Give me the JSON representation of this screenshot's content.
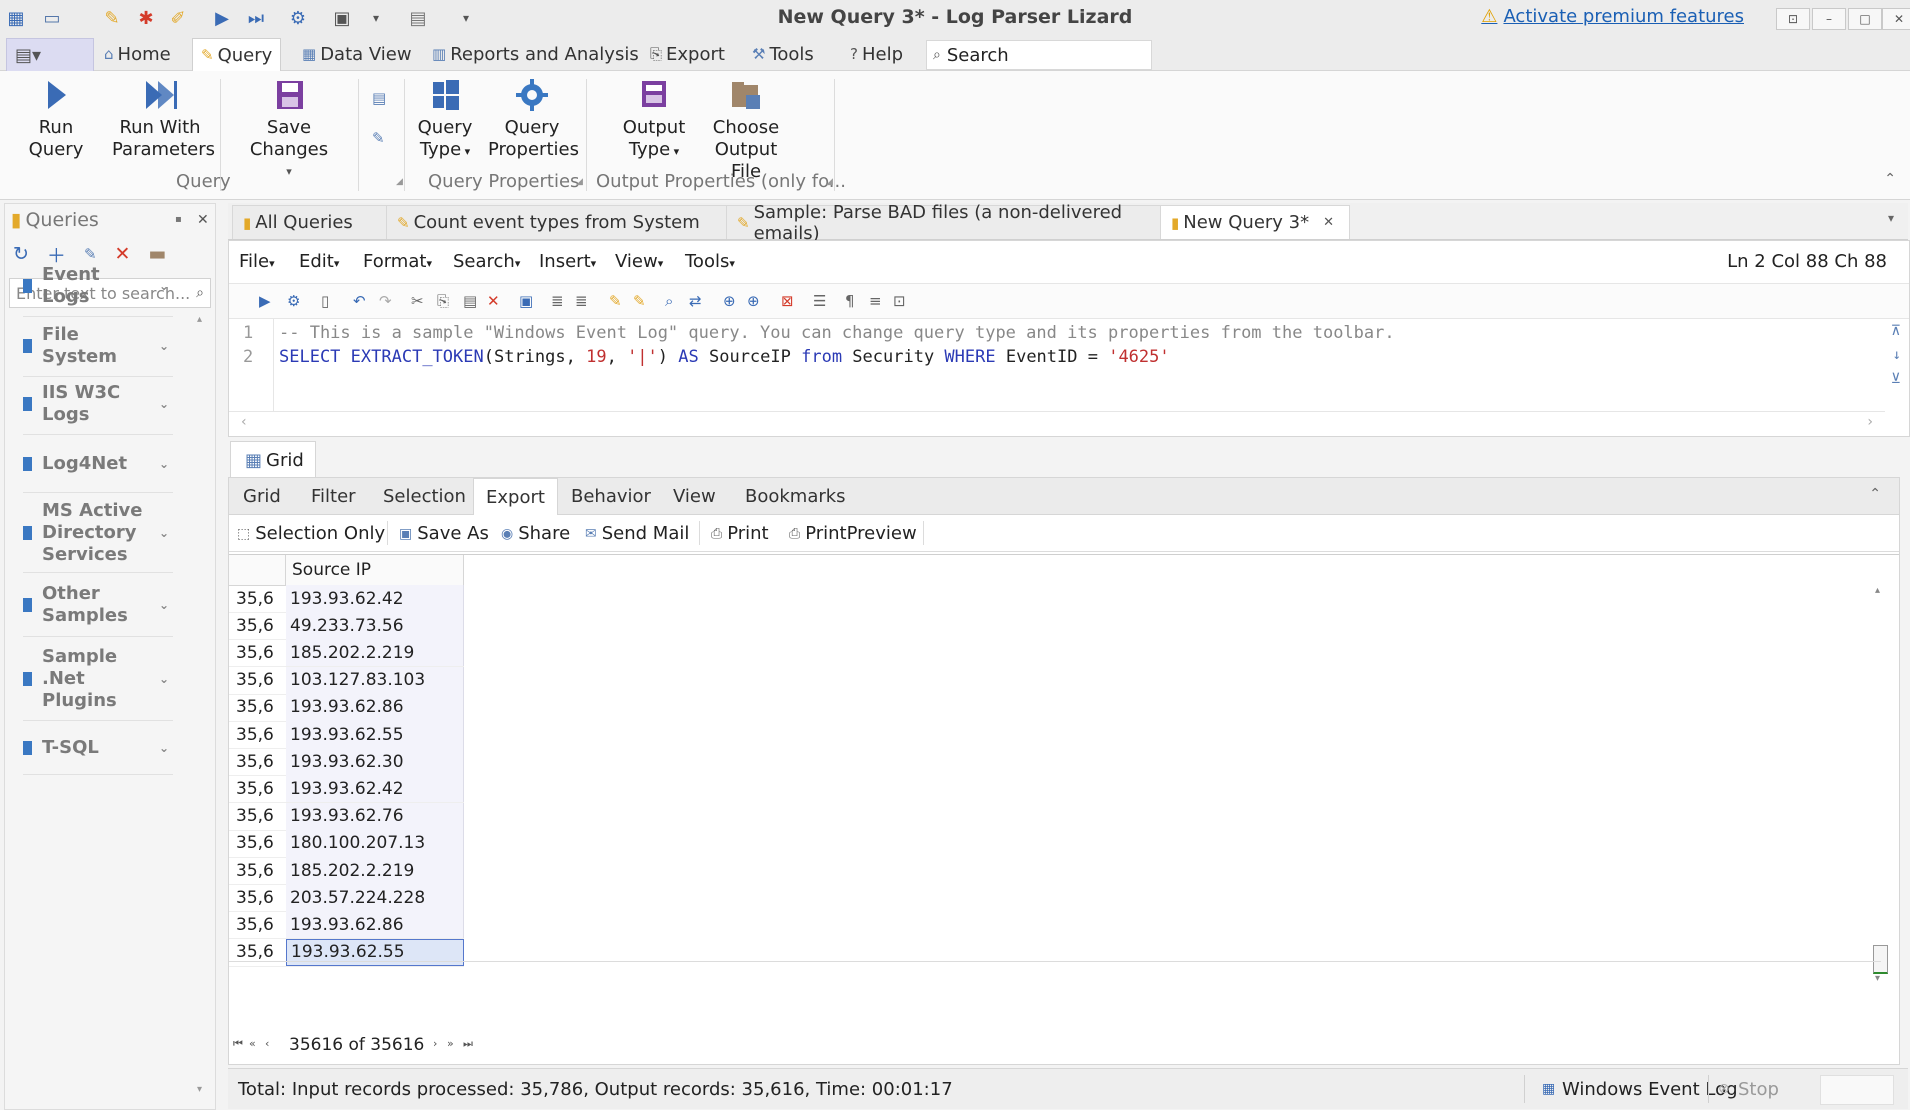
{
  "window": {
    "title": "New Query 3* - Log Parser Lizard",
    "premium_link": "Activate premium features"
  },
  "ribbon_tabs": [
    {
      "label": "Home",
      "icon": "home-icon"
    },
    {
      "label": "Query",
      "icon": "query-icon",
      "active": true
    },
    {
      "label": "Data View",
      "icon": "dataview-icon"
    },
    {
      "label": "Reports and Analysis",
      "icon": "reports-icon"
    },
    {
      "label": "Export",
      "icon": "export-icon"
    },
    {
      "label": "Tools",
      "icon": "tools-icon"
    },
    {
      "label": "Help",
      "icon": "help-icon"
    }
  ],
  "search": {
    "label": "Search"
  },
  "ribbon": {
    "run_query": "Run Query",
    "run_with_params_1": "Run With",
    "run_with_params_2": "Parameters",
    "save_changes": "Save Changes",
    "query_type_1": "Query",
    "query_type_2": "Type",
    "query_props_1": "Query",
    "query_props_2": "Properties",
    "output_type_1": "Output",
    "output_type_2": "Type",
    "choose_output_1": "Choose",
    "choose_output_2": "Output File",
    "group_query": "Query",
    "group_query_props": "Query Properties",
    "group_output_props": "Output Properties (only fo..."
  },
  "left_panel": {
    "title": "Queries",
    "search_placeholder": "Enter text to search...",
    "items": [
      {
        "line1": "Event",
        "line2": "Logs"
      },
      {
        "line1": "File",
        "line2": "System"
      },
      {
        "line1": "IIS W3C",
        "line2": "Logs"
      },
      {
        "line1": "Log4Net",
        "line2": ""
      },
      {
        "line1": "MS Active",
        "line2": "Directory",
        "line3": "Services"
      },
      {
        "line1": "Other",
        "line2": "Samples"
      },
      {
        "line1": "Sample",
        "line2": ".Net",
        "line3": "Plugins"
      },
      {
        "line1": "T-SQL",
        "line2": ""
      }
    ]
  },
  "doc_tabs": [
    {
      "label": "All Queries"
    },
    {
      "label": "Count event types from System"
    },
    {
      "label": "Sample: Parse BAD files (a non-delivered emails)"
    },
    {
      "label": "New Query 3*",
      "active": true
    }
  ],
  "editor": {
    "menu": [
      "File",
      "Edit",
      "Format",
      "Search",
      "Insert",
      "View",
      "Tools"
    ],
    "position": "Ln 2 Col 88 Ch 88",
    "line_numbers": [
      "1",
      "2"
    ],
    "line1": "-- This is a sample \"Windows Event Log\" query. You can change query type and its properties from the toolbar.",
    "line2_parts": {
      "kw_select": "SELECT",
      "fn": "EXTRACT_TOKEN",
      "arg1": "(Strings, ",
      "num": "19",
      "sep": ", ",
      "str1": "'|'",
      "close": ") ",
      "kw_as": "AS",
      "alias": " SourceIP ",
      "kw_from": "from",
      "table": " Security ",
      "kw_where": "WHERE",
      "cond": " EventID = ",
      "str2": "'4625'"
    }
  },
  "results": {
    "grid_tab": "Grid",
    "tabs": [
      "Grid",
      "Filter",
      "Selection",
      "Export",
      "Behavior",
      "View",
      "Bookmarks"
    ],
    "active_tab": "Export",
    "tools": [
      {
        "label": "Selection Only",
        "icon": "selection-icon"
      },
      {
        "label": "Save As",
        "icon": "save-icon"
      },
      {
        "label": "Share",
        "icon": "share-icon"
      },
      {
        "label": "Send Mail",
        "icon": "mail-icon"
      },
      {
        "label": "Print",
        "icon": "print-icon"
      },
      {
        "label": "PrintPreview",
        "icon": "print-preview-icon"
      }
    ],
    "column_header": "Source IP",
    "rows": [
      {
        "num": "35,6",
        "ip": "193.93.62.42"
      },
      {
        "num": "35,6",
        "ip": "49.233.73.56"
      },
      {
        "num": "35,6",
        "ip": "185.202.2.219"
      },
      {
        "num": "35,6",
        "ip": "103.127.83.103"
      },
      {
        "num": "35,6",
        "ip": "193.93.62.86"
      },
      {
        "num": "35,6",
        "ip": "193.93.62.55"
      },
      {
        "num": "35,6",
        "ip": "193.93.62.30"
      },
      {
        "num": "35,6",
        "ip": "193.93.62.42"
      },
      {
        "num": "35,6",
        "ip": "193.93.62.76"
      },
      {
        "num": "35,6",
        "ip": "180.100.207.13"
      },
      {
        "num": "35,6",
        "ip": "185.202.2.219"
      },
      {
        "num": "35,6",
        "ip": "203.57.224.228"
      },
      {
        "num": "35,6",
        "ip": "193.93.62.86"
      },
      {
        "num": "35,6",
        "ip": "193.93.62.55",
        "selected": true
      }
    ],
    "record_nav": "35616 of 35616"
  },
  "status": {
    "summary": "Total: Input records processed: 35,786, Output records: 35,616, Time: 00:01:17",
    "log_type": "Windows Event Log",
    "stop": "Stop"
  }
}
